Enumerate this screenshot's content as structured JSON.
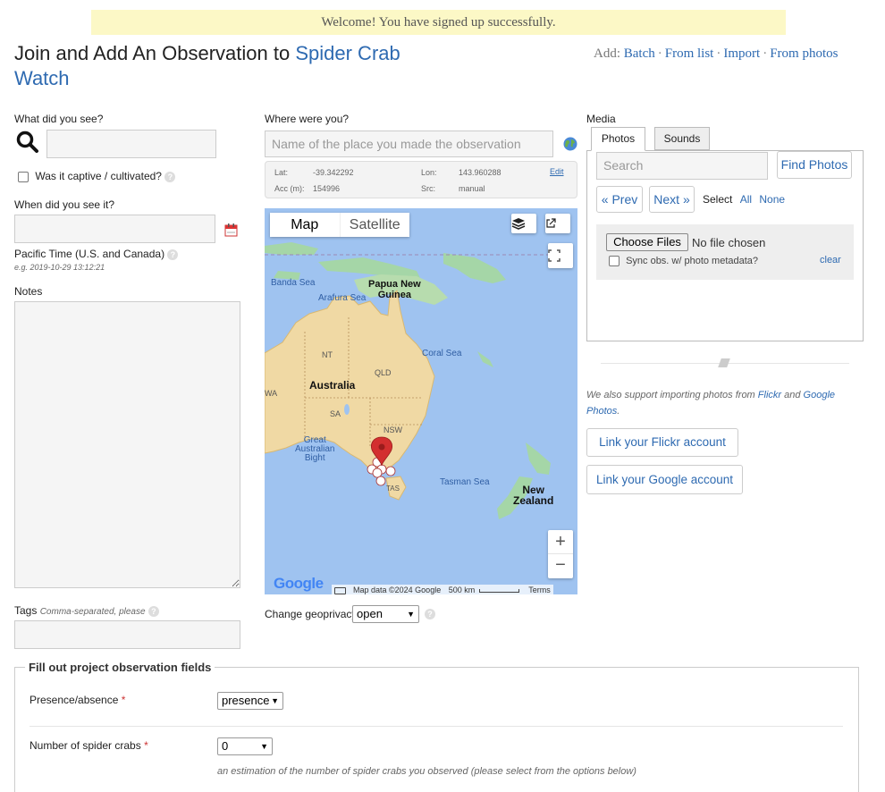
{
  "notice": "Welcome! You have signed up successfully.",
  "title": {
    "prefix": "Join and Add An Observation to",
    "project": "Spider Crab Watch"
  },
  "add_links": {
    "label": "Add:",
    "items": [
      "Batch",
      "From list",
      "Import",
      "From photos"
    ]
  },
  "what": {
    "label": "What did you see?",
    "captive_label": "Was it captive / cultivated?"
  },
  "when": {
    "label": "When did you see it?",
    "timezone": "Pacific Time (U.S. and Canada)",
    "example": "e.g. 2019-10-29 13:12:21"
  },
  "notes_label": "Notes",
  "tags": {
    "label": "Tags",
    "hint": "Comma-separated, please"
  },
  "where": {
    "label": "Where were you?",
    "placeholder": "Name of the place you made the observation",
    "lat_label": "Lat:",
    "lat": "-39.342292",
    "lon_label": "Lon:",
    "lon": "143.960288",
    "acc_label": "Acc (m):",
    "acc": "154996",
    "src_label": "Src:",
    "src": "manual",
    "edit": "Edit"
  },
  "map": {
    "tab_map": "Map",
    "tab_satellite": "Satellite",
    "labels": {
      "banda": "Banda Sea",
      "png1": "Papua New",
      "png2": "Guinea",
      "arafura": "Arafura Sea",
      "coral": "Coral Sea",
      "nt": "NT",
      "qld": "QLD",
      "wa": "WA",
      "australia": "Australia",
      "sa": "SA",
      "nsw": "NSW",
      "gab1": "Great",
      "gab2": "Australian",
      "gab3": "Bight",
      "tas": "TAS",
      "tasman": "Tasman Sea",
      "nz1": "New",
      "nz2": "Zealand"
    },
    "google": "Google",
    "map_data": "Map data ©2024 Google",
    "scale": "500 km",
    "terms": "Terms",
    "zoom_in": "+",
    "zoom_out": "−"
  },
  "geoprivacy": {
    "label": "Change geoprivacy",
    "value": "open"
  },
  "media": {
    "label": "Media",
    "tab_photos": "Photos",
    "tab_sounds": "Sounds",
    "search_placeholder": "Search",
    "find_photos": "Find Photos",
    "prev": "« Prev",
    "next": "Next »",
    "select_label": "Select",
    "select_all": "All",
    "select_none": "None",
    "choose_files": "Choose Files",
    "no_file": "No file chosen",
    "sync_label": "Sync obs. w/ photo metadata?",
    "clear": "clear"
  },
  "import": {
    "text_prefix": "We also support importing photos from",
    "flickr": "Flickr",
    "and": "and",
    "google": "Google Photos",
    "period": ".",
    "flickr_btn": "Link your Flickr account",
    "google_btn": "Link your Google account"
  },
  "project_fields": {
    "legend": "Fill out project observation fields",
    "presence_label": "Presence/absence",
    "presence_value": "presence",
    "count_label": "Number of spider crabs",
    "count_value": "0",
    "count_hint": "an estimation of the number of spider crabs you observed (please select from the options below)",
    "required_mark": "*"
  }
}
